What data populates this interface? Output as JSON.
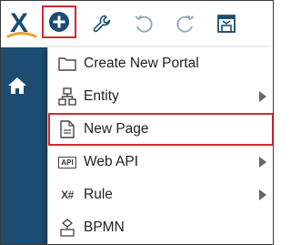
{
  "toolbar": {
    "logo_icon": "x-logo-icon",
    "add_icon": "plus-circle-icon",
    "tools_icon": "wrench-icon",
    "undo_icon": "undo-icon",
    "redo_icon": "redo-icon",
    "save_icon": "save-icon"
  },
  "sidebar": {
    "home_icon": "home-icon",
    "background_color": "#1c4c72"
  },
  "menu": {
    "items": [
      {
        "label": "Create New Portal",
        "icon": "folder-icon",
        "has_submenu": false
      },
      {
        "label": "Entity",
        "icon": "entity-hierarchy-icon",
        "has_submenu": true
      },
      {
        "label": "New Page",
        "icon": "page-icon",
        "has_submenu": false,
        "highlighted": true
      },
      {
        "label": "Web API",
        "icon": "api-icon",
        "icon_text": "API",
        "has_submenu": true
      },
      {
        "label": "Rule",
        "icon": "rule-icon",
        "icon_text": "X#",
        "has_submenu": true
      },
      {
        "label": "BPMN",
        "icon": "bpmn-icon",
        "has_submenu": false
      }
    ]
  },
  "colors": {
    "highlight_border": "#d9262e",
    "brand_blue": "#1c4c72",
    "brand_orange": "#f0a030"
  }
}
